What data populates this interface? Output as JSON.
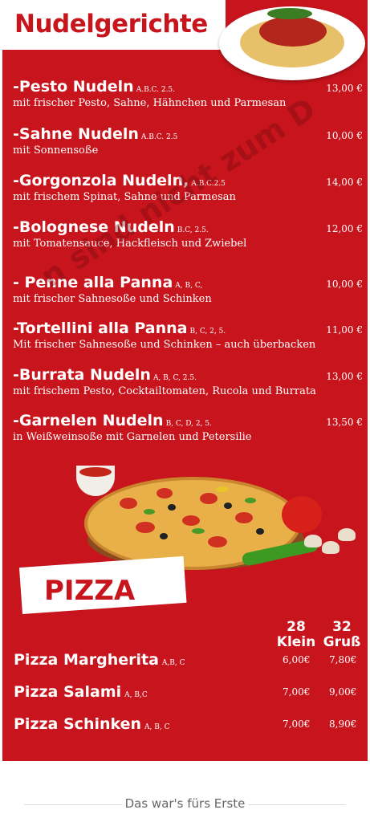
{
  "noodles": {
    "title": "Nudelgerichte",
    "items": [
      {
        "name": "-Pesto Nudeln",
        "allergens": "A.B.C. 2.5.",
        "desc": "mit frischer Pesto, Sahne, Hähnchen und Parmesan",
        "price": "13,00 €"
      },
      {
        "name": "-Sahne Nudeln",
        "allergens": "A.B.C. 2.5",
        "desc": "mit Sonnensoße",
        "price": "10,00 €"
      },
      {
        "name": "-Gorgonzola Nudeln,",
        "allergens": "A.B.C.2.5",
        "desc": "mit frischem Spinat, Sahne und Parmesan",
        "price": "14,00 €"
      },
      {
        "name": "-Bolognese Nudeln",
        "allergens": "B.C, 2.5.",
        "desc": "mit Tomatensauce, Hackfleisch und Zwiebel",
        "price": "12,00 €"
      },
      {
        "name": "- Penne alla Panna",
        "allergens": "A, B, C,",
        "desc": "mit frischer Sahnesoße und Schinken",
        "price": "10,00 €"
      },
      {
        "name": "-Tortellini alla Panna",
        "allergens": "B, C, 2, 5.",
        "desc": "Mit frischer Sahnesoße und Schinken – auch überbacken",
        "price": "11,00 €"
      },
      {
        "name": "-Burrata Nudeln",
        "allergens": "A, B, C, 2.5.",
        "desc": "mit frischem Pesto, Cocktailtomaten, Rucola und Burrata",
        "price": "13,00 €"
      },
      {
        "name": "-Garnelen Nudeln",
        "allergens": "B, C, D, 2, 5.",
        "desc": "in Weißweinsoße mit Garnelen  und Petersilie",
        "price": "13,50 €"
      }
    ]
  },
  "watermark": "n sind nicht zum D",
  "pizza": {
    "title": "PIZZA",
    "sizes": [
      {
        "number": "28",
        "label": "Klein"
      },
      {
        "number": "32",
        "label": "Gruß"
      }
    ],
    "items": [
      {
        "name": "Pizza Margherita",
        "allergens": "A,B, C",
        "small": "6,00€",
        "large": "7,80€"
      },
      {
        "name": "Pizza Salami",
        "allergens": "A, B,C",
        "small": "7,00€",
        "large": "9,00€"
      },
      {
        "name": "Pizza Schinken",
        "allergens": "A, B, C",
        "small": "7,00€",
        "large": "8,90€"
      }
    ]
  },
  "footer": "Das war's fürs Erste",
  "colors": {
    "menu_red": "#c8141c",
    "text": "#ffffff"
  },
  "images": [
    "pasta-plate-image",
    "pizza-image"
  ]
}
